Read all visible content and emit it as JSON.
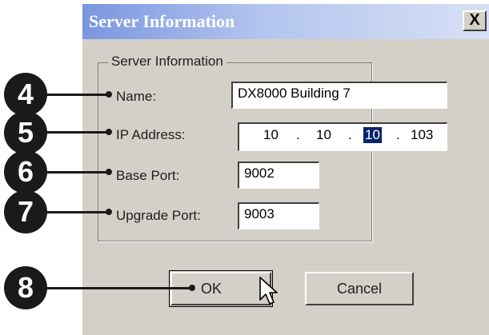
{
  "window": {
    "title": "Server Information",
    "close_glyph": "X"
  },
  "group": {
    "legend": "Server Information"
  },
  "form": {
    "name_label": "Name:",
    "name_value": "DX8000 Building 7",
    "ip_label": "IP Address:",
    "ip_octets": [
      "10",
      "10",
      "10",
      "103"
    ],
    "ip_separator": ".",
    "base_port_label": "Base Port:",
    "base_port_value": "9002",
    "upgrade_port_label": "Upgrade Port:",
    "upgrade_port_value": "9003"
  },
  "buttons": {
    "ok_label": "OK",
    "cancel_label": "Cancel"
  },
  "callouts": [
    "4",
    "5",
    "6",
    "7",
    "8"
  ],
  "colors": {
    "dialog_bg": "#d4d0c8",
    "titlebar_start": "#7a96df",
    "selection": "#0a246a",
    "callout": "#1a1a1a"
  }
}
